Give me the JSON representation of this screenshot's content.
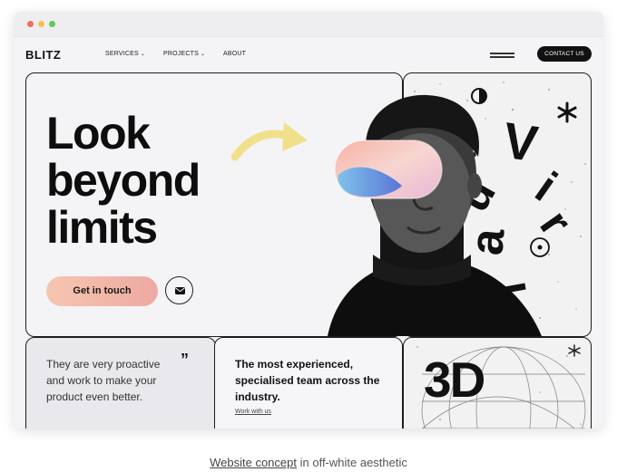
{
  "window": {
    "dots": [
      "#f36b5f",
      "#f5bf4f",
      "#5fcb56"
    ]
  },
  "nav": {
    "logo": "BLITZ",
    "links": [
      {
        "label": "SERVICES",
        "has_dropdown": true,
        "icon": "chevron-down-icon"
      },
      {
        "label": "PROJECTS",
        "has_dropdown": true,
        "icon": "chevron-down-icon"
      },
      {
        "label": "ABOUT",
        "has_dropdown": false
      }
    ],
    "menu_icon": "hamburger-menu-icon",
    "contact_label": "CONTACT US"
  },
  "hero": {
    "headline_lines": [
      "Look",
      "beyond",
      "limits"
    ],
    "cta_label": "Get in touch",
    "mail_icon": "envelope-icon",
    "arrow_icon": "curved-arrow-icon",
    "accent_colors": {
      "arrow": "#f1e08a",
      "cta_start": "#f6c6b0",
      "cta_end": "#eea9a3"
    }
  },
  "art": {
    "vertical_word_letters": [
      "V",
      "i",
      "r",
      "t",
      "u",
      "a",
      "l"
    ],
    "symbols": [
      "half-circle-icon",
      "asterisk-icon",
      "target-icon"
    ]
  },
  "quote": {
    "text": "They are very proactive and work to make your product even better.",
    "mark": "”"
  },
  "team": {
    "text": "The most experienced, specialised team across the industry.",
    "link": "Work with us"
  },
  "threed": {
    "label": "3D"
  },
  "caption": {
    "link": "Website concept",
    "rest": "in off-white aesthetic"
  }
}
